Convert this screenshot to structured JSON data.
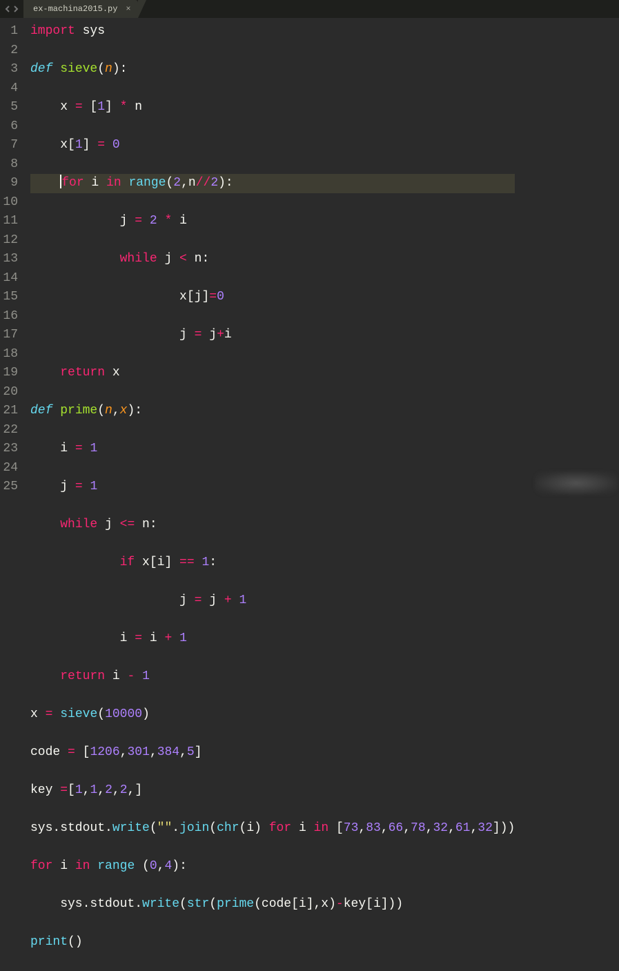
{
  "tab": {
    "filename": "ex-machina2015.py",
    "close_glyph": "×"
  },
  "gutter": {
    "count": 25
  },
  "code": {
    "active_line": 5,
    "lines": [
      [
        {
          "t": "import ",
          "c": "kw-import"
        },
        {
          "t": "sys",
          "c": "id"
        }
      ],
      [
        {
          "t": "def ",
          "c": "kw-def"
        },
        {
          "t": "sieve",
          "c": "fn-decl"
        },
        {
          "t": "(",
          "c": "punct"
        },
        {
          "t": "n",
          "c": "fn-param"
        },
        {
          "t": "):",
          "c": "punct"
        }
      ],
      [
        {
          "t": "    x ",
          "c": "id"
        },
        {
          "t": "=",
          "c": "op"
        },
        {
          "t": " [",
          "c": "punct"
        },
        {
          "t": "1",
          "c": "num"
        },
        {
          "t": "] ",
          "c": "punct"
        },
        {
          "t": "*",
          "c": "op"
        },
        {
          "t": " n",
          "c": "id"
        }
      ],
      [
        {
          "t": "    x[",
          "c": "id"
        },
        {
          "t": "1",
          "c": "num"
        },
        {
          "t": "] ",
          "c": "punct"
        },
        {
          "t": "=",
          "c": "op"
        },
        {
          "t": " ",
          "c": "id"
        },
        {
          "t": "0",
          "c": "num"
        }
      ],
      [
        {
          "t": "    ",
          "c": "id",
          "cursor": true
        },
        {
          "t": "for",
          "c": "kw-flow"
        },
        {
          "t": " i ",
          "c": "id"
        },
        {
          "t": "in",
          "c": "kw-flow"
        },
        {
          "t": " ",
          "c": "id"
        },
        {
          "t": "range",
          "c": "fn-call"
        },
        {
          "t": "(",
          "c": "punct"
        },
        {
          "t": "2",
          "c": "num"
        },
        {
          "t": ",n",
          "c": "id"
        },
        {
          "t": "//",
          "c": "op"
        },
        {
          "t": "2",
          "c": "num"
        },
        {
          "t": "):",
          "c": "punct"
        }
      ],
      [
        {
          "t": "            j ",
          "c": "id"
        },
        {
          "t": "=",
          "c": "op"
        },
        {
          "t": " ",
          "c": "id"
        },
        {
          "t": "2",
          "c": "num"
        },
        {
          "t": " ",
          "c": "id"
        },
        {
          "t": "*",
          "c": "op"
        },
        {
          "t": " i",
          "c": "id"
        }
      ],
      [
        {
          "t": "            ",
          "c": "id"
        },
        {
          "t": "while",
          "c": "kw-flow"
        },
        {
          "t": " j ",
          "c": "id"
        },
        {
          "t": "<",
          "c": "op"
        },
        {
          "t": " n:",
          "c": "id"
        }
      ],
      [
        {
          "t": "                    x[j]",
          "c": "id"
        },
        {
          "t": "=",
          "c": "op"
        },
        {
          "t": "0",
          "c": "num"
        }
      ],
      [
        {
          "t": "                    j ",
          "c": "id"
        },
        {
          "t": "=",
          "c": "op"
        },
        {
          "t": " j",
          "c": "id"
        },
        {
          "t": "+",
          "c": "op"
        },
        {
          "t": "i",
          "c": "id"
        }
      ],
      [
        {
          "t": "    ",
          "c": "id"
        },
        {
          "t": "return",
          "c": "kw-flow"
        },
        {
          "t": " x",
          "c": "id"
        }
      ],
      [
        {
          "t": "def ",
          "c": "kw-def"
        },
        {
          "t": "prime",
          "c": "fn-decl"
        },
        {
          "t": "(",
          "c": "punct"
        },
        {
          "t": "n",
          "c": "fn-param"
        },
        {
          "t": ",",
          "c": "punct"
        },
        {
          "t": "x",
          "c": "fn-param"
        },
        {
          "t": "):",
          "c": "punct"
        }
      ],
      [
        {
          "t": "    i ",
          "c": "id"
        },
        {
          "t": "=",
          "c": "op"
        },
        {
          "t": " ",
          "c": "id"
        },
        {
          "t": "1",
          "c": "num"
        }
      ],
      [
        {
          "t": "    j ",
          "c": "id"
        },
        {
          "t": "=",
          "c": "op"
        },
        {
          "t": " ",
          "c": "id"
        },
        {
          "t": "1",
          "c": "num"
        }
      ],
      [
        {
          "t": "    ",
          "c": "id"
        },
        {
          "t": "while",
          "c": "kw-flow"
        },
        {
          "t": " j ",
          "c": "id"
        },
        {
          "t": "<=",
          "c": "op"
        },
        {
          "t": " n:",
          "c": "id"
        }
      ],
      [
        {
          "t": "            ",
          "c": "id"
        },
        {
          "t": "if",
          "c": "kw-flow"
        },
        {
          "t": " x[i] ",
          "c": "id"
        },
        {
          "t": "==",
          "c": "op"
        },
        {
          "t": " ",
          "c": "id"
        },
        {
          "t": "1",
          "c": "num"
        },
        {
          "t": ":",
          "c": "punct"
        }
      ],
      [
        {
          "t": "                    j ",
          "c": "id"
        },
        {
          "t": "=",
          "c": "op"
        },
        {
          "t": " j ",
          "c": "id"
        },
        {
          "t": "+",
          "c": "op"
        },
        {
          "t": " ",
          "c": "id"
        },
        {
          "t": "1",
          "c": "num"
        }
      ],
      [
        {
          "t": "            i ",
          "c": "id"
        },
        {
          "t": "=",
          "c": "op"
        },
        {
          "t": " i ",
          "c": "id"
        },
        {
          "t": "+",
          "c": "op"
        },
        {
          "t": " ",
          "c": "id"
        },
        {
          "t": "1",
          "c": "num"
        }
      ],
      [
        {
          "t": "    ",
          "c": "id"
        },
        {
          "t": "return",
          "c": "kw-flow"
        },
        {
          "t": " i ",
          "c": "id"
        },
        {
          "t": "-",
          "c": "op"
        },
        {
          "t": " ",
          "c": "id"
        },
        {
          "t": "1",
          "c": "num"
        }
      ],
      [
        {
          "t": "x ",
          "c": "id"
        },
        {
          "t": "=",
          "c": "op"
        },
        {
          "t": " ",
          "c": "id"
        },
        {
          "t": "sieve",
          "c": "fn-call"
        },
        {
          "t": "(",
          "c": "punct"
        },
        {
          "t": "10000",
          "c": "num"
        },
        {
          "t": ")",
          "c": "punct"
        }
      ],
      [
        {
          "t": "code ",
          "c": "id"
        },
        {
          "t": "=",
          "c": "op"
        },
        {
          "t": " [",
          "c": "punct"
        },
        {
          "t": "1206",
          "c": "num"
        },
        {
          "t": ",",
          "c": "punct"
        },
        {
          "t": "301",
          "c": "num"
        },
        {
          "t": ",",
          "c": "punct"
        },
        {
          "t": "384",
          "c": "num"
        },
        {
          "t": ",",
          "c": "punct"
        },
        {
          "t": "5",
          "c": "num"
        },
        {
          "t": "]",
          "c": "punct"
        }
      ],
      [
        {
          "t": "key ",
          "c": "id"
        },
        {
          "t": "=",
          "c": "op"
        },
        {
          "t": "[",
          "c": "punct"
        },
        {
          "t": "1",
          "c": "num"
        },
        {
          "t": ",",
          "c": "punct"
        },
        {
          "t": "1",
          "c": "num"
        },
        {
          "t": ",",
          "c": "punct"
        },
        {
          "t": "2",
          "c": "num"
        },
        {
          "t": ",",
          "c": "punct"
        },
        {
          "t": "2",
          "c": "num"
        },
        {
          "t": ",]",
          "c": "punct"
        }
      ],
      [
        {
          "t": "sys.stdout.",
          "c": "id"
        },
        {
          "t": "write",
          "c": "fn-call"
        },
        {
          "t": "(",
          "c": "punct"
        },
        {
          "t": "\"\"",
          "c": "str"
        },
        {
          "t": ".",
          "c": "punct"
        },
        {
          "t": "join",
          "c": "fn-call"
        },
        {
          "t": "(",
          "c": "punct"
        },
        {
          "t": "chr",
          "c": "fn-call"
        },
        {
          "t": "(i) ",
          "c": "id"
        },
        {
          "t": "for",
          "c": "kw-flow"
        },
        {
          "t": " i ",
          "c": "id"
        },
        {
          "t": "in",
          "c": "kw-flow"
        },
        {
          "t": " [",
          "c": "punct"
        },
        {
          "t": "73",
          "c": "num"
        },
        {
          "t": ",",
          "c": "punct"
        },
        {
          "t": "83",
          "c": "num"
        },
        {
          "t": ",",
          "c": "punct"
        },
        {
          "t": "66",
          "c": "num"
        },
        {
          "t": ",",
          "c": "punct"
        },
        {
          "t": "78",
          "c": "num"
        },
        {
          "t": ",",
          "c": "punct"
        },
        {
          "t": "32",
          "c": "num"
        },
        {
          "t": ",",
          "c": "punct"
        },
        {
          "t": "61",
          "c": "num"
        },
        {
          "t": ",",
          "c": "punct"
        },
        {
          "t": "32",
          "c": "num"
        },
        {
          "t": "]))",
          "c": "punct"
        }
      ],
      [
        {
          "t": "for",
          "c": "kw-flow"
        },
        {
          "t": " i ",
          "c": "id"
        },
        {
          "t": "in",
          "c": "kw-flow"
        },
        {
          "t": " ",
          "c": "id"
        },
        {
          "t": "range",
          "c": "fn-call"
        },
        {
          "t": " (",
          "c": "punct"
        },
        {
          "t": "0",
          "c": "num"
        },
        {
          "t": ",",
          "c": "punct"
        },
        {
          "t": "4",
          "c": "num"
        },
        {
          "t": "):",
          "c": "punct"
        }
      ],
      [
        {
          "t": "    sys.stdout.",
          "c": "id"
        },
        {
          "t": "write",
          "c": "fn-call"
        },
        {
          "t": "(",
          "c": "punct"
        },
        {
          "t": "str",
          "c": "fn-call"
        },
        {
          "t": "(",
          "c": "punct"
        },
        {
          "t": "prime",
          "c": "fn-call"
        },
        {
          "t": "(code[i],x)",
          "c": "id"
        },
        {
          "t": "-",
          "c": "op"
        },
        {
          "t": "key[i]))",
          "c": "id"
        }
      ],
      [
        {
          "t": "print",
          "c": "fn-call"
        },
        {
          "t": "()",
          "c": "punct"
        }
      ]
    ]
  }
}
